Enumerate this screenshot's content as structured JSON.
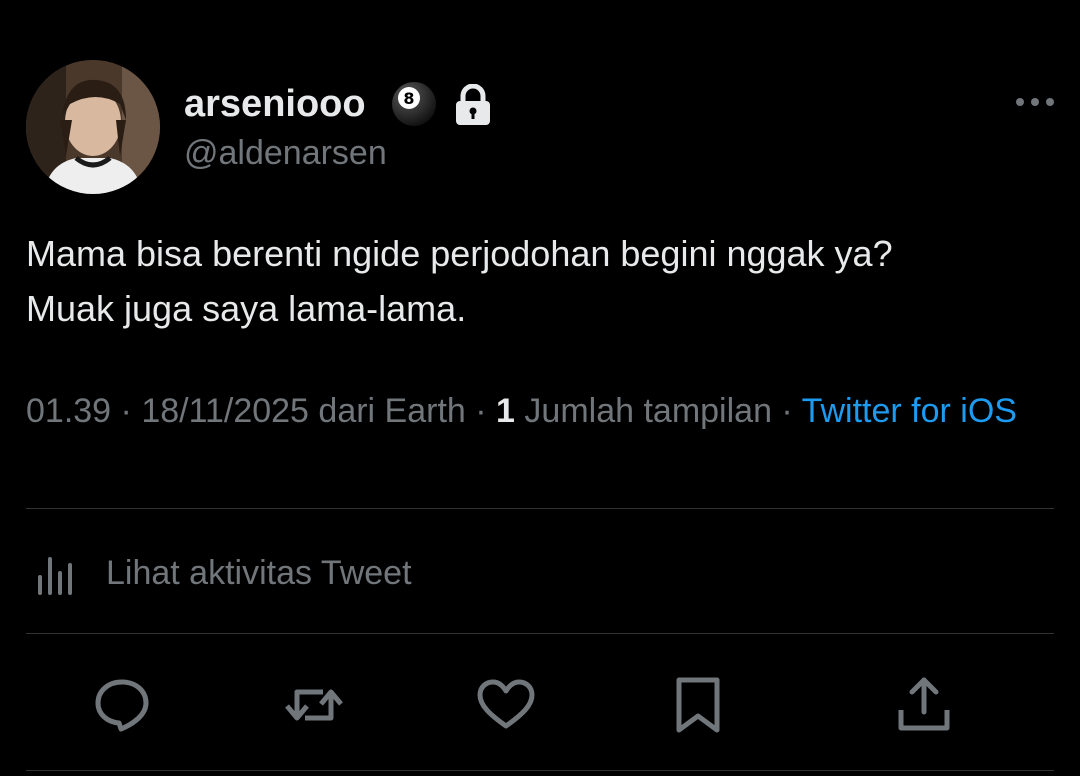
{
  "user": {
    "display_name": "arseniooo",
    "handle": "@aldenarsen",
    "badges": [
      "8-ball-emoji",
      "lock-icon"
    ]
  },
  "tweet": {
    "text_line1": "Mama bisa berenti ngide perjodohan begini nggak ya?",
    "text_line2": "Muak juga saya lama-lama."
  },
  "meta": {
    "time": "01.39",
    "sep1": " · ",
    "date": "18/11/2025",
    "location": " dari Earth",
    "sep2": " · ",
    "views_count": "1",
    "views_label": " Jumlah tampilan",
    "sep3": " · ",
    "source": "Twitter for iOS"
  },
  "activity": {
    "label": "Lihat aktivitas Tweet"
  },
  "actions": [
    "reply-icon",
    "retweet-icon",
    "like-icon",
    "bookmark-icon",
    "share-icon"
  ],
  "colors": {
    "background": "#000000",
    "text": "#e7e9ea",
    "muted": "#71767b",
    "link": "#1d9bf0",
    "divider": "#2f3336"
  }
}
